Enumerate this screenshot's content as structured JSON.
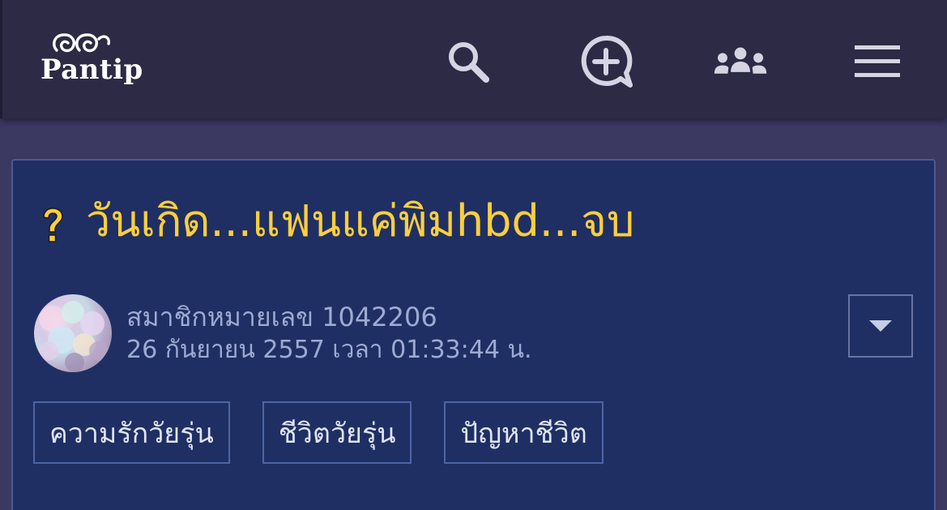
{
  "header": {
    "logo_text": "Pantip",
    "icons": {
      "search": "search-icon",
      "new_post": "add-comment-icon",
      "community": "group-icon",
      "menu": "hamburger-menu-icon"
    }
  },
  "post": {
    "type_icon": "question-mark-icon",
    "title": "วันเกิด...แฟนแค่พิมhbd...จบ",
    "author": "สมาชิกหมายเลข 1042206",
    "datetime": "26 กันยายน 2557 เวลา 01:33:44 น.",
    "options_icon": "caret-down-icon",
    "tags": [
      {
        "label": "ความรักวัยรุ่น"
      },
      {
        "label": "ชีวิตวัยรุ่น"
      },
      {
        "label": "ปัญหาชีวิต"
      }
    ]
  },
  "colors": {
    "header_bg": "#2d2a45",
    "page_bg": "#3b3862",
    "card_bg": "#1f2f63",
    "title": "#fcce3f",
    "meta_text": "#9eaad3",
    "tag_border": "#4f64a4"
  }
}
